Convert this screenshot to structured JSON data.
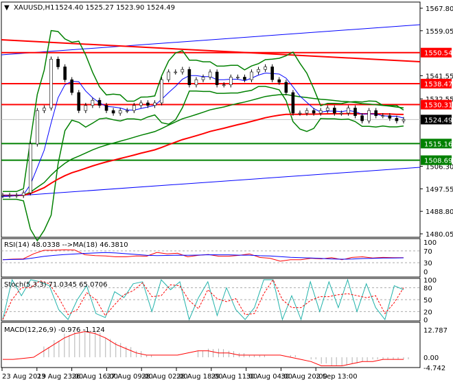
{
  "header": {
    "symbol": "XAUUSD,H1",
    "ohlc": "1524.40 1525.27 1523.90 1524.49"
  },
  "chart_data": {
    "type": "line",
    "title": "XAUUSD,H1",
    "price_axis": {
      "ylim": [
        1480.05,
        1567.8
      ],
      "ticks": [
        "1567.80",
        "1559.05",
        "1541.55",
        "1532.55",
        "1506.30",
        "1497.55",
        "1488.80",
        "1480.05"
      ]
    },
    "x_labels": [
      "23 Aug 2019",
      "23 Aug 23:00",
      "26 Aug 16:00",
      "27 Aug 09:00",
      "28 Aug 02:00",
      "28 Aug 18:00",
      "29 Aug 11:00",
      "30 Aug 04:00",
      "30 Aug 20:00",
      "2 Sep 13:00"
    ],
    "close": [
      1495,
      1495,
      1495,
      1496,
      1515,
      1528,
      1529,
      1548,
      1545,
      1540,
      1535,
      1528,
      1530,
      1532,
      1530,
      1528,
      1527,
      1528,
      1528,
      1530,
      1531,
      1530,
      1531,
      1540,
      1543,
      1543,
      1544,
      1538,
      1540,
      1541,
      1543,
      1538,
      1538,
      1541,
      1541,
      1540,
      1543,
      1544,
      1545,
      1540,
      1539,
      1535,
      1527,
      1527,
      1528,
      1527,
      1528,
      1529,
      1527,
      1527,
      1529,
      1526,
      1524,
      1528,
      1526,
      1526,
      1525,
      1524,
      1524.49
    ],
    "levels": [
      {
        "label": "1550.54",
        "value": 1550.54,
        "color": "#ff0000"
      },
      {
        "label": "1538.47",
        "value": 1538.47,
        "color": "#ff0000"
      },
      {
        "label": "1530.31",
        "value": 1530.31,
        "color": "#ff0000"
      },
      {
        "label": "1515.16",
        "value": 1515.16,
        "color": "#008000"
      },
      {
        "label": "1508.69",
        "value": 1508.69,
        "color": "#008000"
      }
    ],
    "current": {
      "label": "1524.49",
      "value": 1524.49
    },
    "rsi": {
      "label": "RSI(14) 48.0338 -->MA(18) 46.3810",
      "ticks": [
        "100",
        "70",
        "30",
        "0"
      ],
      "values": [
        40,
        42,
        43,
        60,
        72,
        72,
        74,
        73,
        57,
        54,
        53,
        50,
        50,
        53,
        52,
        65,
        60,
        62,
        50,
        55,
        58,
        52,
        52,
        55,
        60,
        48,
        45,
        35,
        40,
        40,
        45,
        43,
        47,
        40,
        48,
        50,
        46,
        48,
        47,
        47
      ]
    },
    "stoch": {
      "label": "Stoch(5,3,3) 71.0345 65.0706",
      "ticks": [
        "100",
        "80",
        "50",
        "20",
        "0"
      ],
      "values": [
        0,
        100,
        60,
        100,
        95,
        85,
        25,
        0,
        50,
        85,
        15,
        5,
        70,
        55,
        90,
        95,
        20,
        100,
        75,
        95,
        0,
        55,
        95,
        10,
        80,
        25,
        0,
        30,
        100,
        100,
        0,
        60,
        0,
        95,
        20,
        95,
        30,
        100,
        20,
        90,
        30,
        0,
        85,
        75
      ]
    },
    "macd": {
      "label": "MACD(12,26,9) -0.976 -1.124",
      "ticks": [
        "12.787",
        "0.00",
        "-4.742"
      ],
      "hist": [
        0,
        0,
        0,
        0,
        5,
        8,
        11,
        12,
        13,
        12,
        9,
        7,
        5,
        3,
        1,
        0,
        0,
        0,
        0,
        3,
        4,
        4,
        3,
        2,
        1,
        1,
        0,
        0,
        1,
        0,
        -1,
        -3,
        -4,
        -4,
        -3,
        -2,
        -1,
        -1,
        -1,
        -1
      ],
      "signal": [
        -1,
        -1,
        -0.5,
        0,
        3,
        6,
        9,
        11,
        12,
        11,
        9,
        6,
        4,
        2,
        1,
        1,
        1,
        1,
        2,
        3,
        3,
        2,
        2,
        1,
        1,
        1,
        1,
        1,
        0,
        -1,
        -2,
        -4,
        -4,
        -4,
        -3,
        -2,
        -2,
        -1,
        -1,
        -1
      ]
    }
  }
}
